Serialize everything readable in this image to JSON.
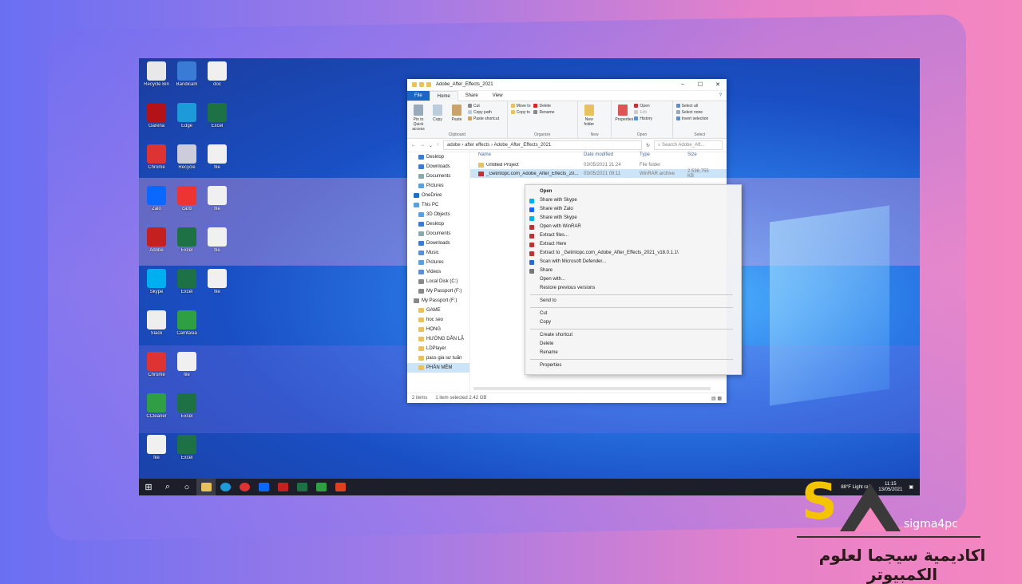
{
  "desktop_icons": [
    {
      "label": "Recycle Bin",
      "color": "#e8e8e8"
    },
    {
      "label": "Bandicam",
      "color": "#3a7bd5"
    },
    {
      "label": "doc",
      "color": "#f0f0f0"
    },
    {
      "label": "Garena",
      "color": "#b31217"
    },
    {
      "label": "Edge",
      "color": "#1d9bd8"
    },
    {
      "label": "Excel",
      "color": "#1e7145"
    },
    {
      "label": "Chrome",
      "color": "#d33"
    },
    {
      "label": "Recycle",
      "color": "#ccd"
    },
    {
      "label": "file",
      "color": "#f0f0f0"
    },
    {
      "label": "Zalo",
      "color": "#0a68ff"
    },
    {
      "label": "card",
      "color": "#e33"
    },
    {
      "label": "file",
      "color": "#f0f0f0"
    },
    {
      "label": "Adobe",
      "color": "#c42020"
    },
    {
      "label": "Excel",
      "color": "#1e7145"
    },
    {
      "label": "file",
      "color": "#f0f0f0"
    },
    {
      "label": "Skype",
      "color": "#00aff0"
    },
    {
      "label": "Excel",
      "color": "#1e7145"
    },
    {
      "label": "file",
      "color": "#f0f0f0"
    },
    {
      "label": "Slack",
      "color": "#eee"
    },
    {
      "label": "Camtasia",
      "color": "#2ea043"
    },
    {
      "label": "",
      "color": "transparent"
    },
    {
      "label": "Chrome",
      "color": "#d33"
    },
    {
      "label": "file",
      "color": "#f0f0f0"
    },
    {
      "label": "",
      "color": "transparent"
    },
    {
      "label": "CCleaner",
      "color": "#2f9e44"
    },
    {
      "label": "Excel",
      "color": "#1e7145"
    },
    {
      "label": "",
      "color": "transparent"
    },
    {
      "label": "file",
      "color": "#f0f0f0"
    },
    {
      "label": "Excel",
      "color": "#1e7145"
    }
  ],
  "taskbar": {
    "weather": "88°F  Light rain",
    "time": "11:15",
    "date": "13/05/2021"
  },
  "explorer": {
    "title": "Adobe_After_Effects_2021",
    "tabs": [
      "File",
      "Home",
      "Share",
      "View"
    ],
    "ribbon": {
      "clipboard": {
        "name": "Clipboard",
        "pin": "Pin to Quick access",
        "copy": "Copy",
        "paste": "Paste",
        "cut": "Cut",
        "copy_path": "Copy path",
        "paste_shortcut": "Paste shortcut"
      },
      "organize": {
        "name": "Organize",
        "move_to": "Move to",
        "copy_to": "Copy to",
        "delete": "Delete",
        "rename": "Rename"
      },
      "new": {
        "name": "New",
        "new_folder": "New folder"
      },
      "open": {
        "name": "Open",
        "properties": "Properties",
        "open": "Open",
        "edit": "Edit",
        "history": "History"
      },
      "select": {
        "name": "Select",
        "select_all": "Select all",
        "select_none": "Select none",
        "invert": "Invert selection"
      }
    },
    "breadcrumb": [
      "adobe",
      "after effects",
      "Adobe_After_Effects_2021"
    ],
    "search_placeholder": "Search Adobe_Aft...",
    "nav": [
      {
        "label": "Desktop",
        "color": "#3a7bd5",
        "cls": "sub"
      },
      {
        "label": "Downloads",
        "color": "#3a7bd5",
        "cls": "sub"
      },
      {
        "label": "Documents",
        "color": "#8aa",
        "cls": "sub"
      },
      {
        "label": "Pictures",
        "color": "#5aa0e0",
        "cls": "sub"
      },
      {
        "label": "OneDrive",
        "color": "#1a6fd1",
        "cls": ""
      },
      {
        "label": "This PC",
        "color": "#5aa0e0",
        "cls": ""
      },
      {
        "label": "3D Objects",
        "color": "#5aa0e0",
        "cls": "sub"
      },
      {
        "label": "Desktop",
        "color": "#3a7bd5",
        "cls": "sub"
      },
      {
        "label": "Documents",
        "color": "#8aa",
        "cls": "sub"
      },
      {
        "label": "Downloads",
        "color": "#3a7bd5",
        "cls": "sub"
      },
      {
        "label": "Music",
        "color": "#5a8fd0",
        "cls": "sub"
      },
      {
        "label": "Pictures",
        "color": "#5aa0e0",
        "cls": "sub"
      },
      {
        "label": "Videos",
        "color": "#5a8fd0",
        "cls": "sub"
      },
      {
        "label": "Local Disk (C:)",
        "color": "#888",
        "cls": "sub"
      },
      {
        "label": "My Passport (F:)",
        "color": "#888",
        "cls": "sub"
      },
      {
        "label": "My Passport (F:)",
        "color": "#888",
        "cls": ""
      },
      {
        "label": "GAME",
        "color": "#e8c25c",
        "cls": "sub"
      },
      {
        "label": "hoc seo",
        "color": "#e8c25c",
        "cls": "sub"
      },
      {
        "label": "HỌNG",
        "color": "#e8c25c",
        "cls": "sub"
      },
      {
        "label": "HƯỚNG DẪN LẬ",
        "color": "#e8c25c",
        "cls": "sub"
      },
      {
        "label": "LDPlayer",
        "color": "#e8c25c",
        "cls": "sub"
      },
      {
        "label": "pass gia sư tuấn",
        "color": "#e8c25c",
        "cls": "sub"
      },
      {
        "label": "PHẦN MỀM",
        "color": "#e8c25c",
        "cls": "sub sel"
      }
    ],
    "columns": {
      "name": "Name",
      "date": "Date modified",
      "type": "Type",
      "size": "Size"
    },
    "files": [
      {
        "name": "Untitled Project",
        "date": "03/05/2021 21:24",
        "type": "File folder",
        "size": "",
        "color": "#e8c25c",
        "cls": ""
      },
      {
        "name": "_Getintopc.com_Adobe_After_Effects_20...",
        "date": "03/05/2021 09:11",
        "type": "WinRAR archive",
        "size": "2,536,755 KB",
        "color": "#b33",
        "cls": "sel"
      }
    ],
    "status": {
      "count": "2 items",
      "selected": "1 item selected  2.42 GB"
    }
  },
  "context_menu": [
    {
      "label": "Open",
      "color": "",
      "bold": true
    },
    {
      "label": "Share with Skype",
      "color": "#00aff0"
    },
    {
      "label": "Share with Zalo",
      "color": "#0a68ff"
    },
    {
      "label": "Share with Skype",
      "color": "#00aff0"
    },
    {
      "label": "Open with WinRAR",
      "color": "#b33"
    },
    {
      "label": "Extract files...",
      "color": "#b33"
    },
    {
      "label": "Extract Here",
      "color": "#b33"
    },
    {
      "label": "Extract to _Getintopc.com_Adobe_After_Effects_2021_v18.0.1.1\\",
      "color": "#b33"
    },
    {
      "label": "Scan with Microsoft Defender...",
      "color": "#2a6ad0"
    },
    {
      "label": "Share",
      "color": "#777"
    },
    {
      "label": "Open with...",
      "color": ""
    },
    {
      "label": "Restore previous versions",
      "color": ""
    },
    {
      "sep": true
    },
    {
      "label": "Send to",
      "color": ""
    },
    {
      "sep": true
    },
    {
      "label": "Cut",
      "color": ""
    },
    {
      "label": "Copy",
      "color": ""
    },
    {
      "sep": true
    },
    {
      "label": "Create shortcut",
      "color": ""
    },
    {
      "label": "Delete",
      "color": ""
    },
    {
      "label": "Rename",
      "color": ""
    },
    {
      "sep": true
    },
    {
      "label": "Properties",
      "color": ""
    }
  ],
  "brand": {
    "logo_text": "sigma4pc",
    "arabic": "اكاديمية سيجما لعلوم الكمبيوتر",
    "accent": "#f5c400"
  }
}
